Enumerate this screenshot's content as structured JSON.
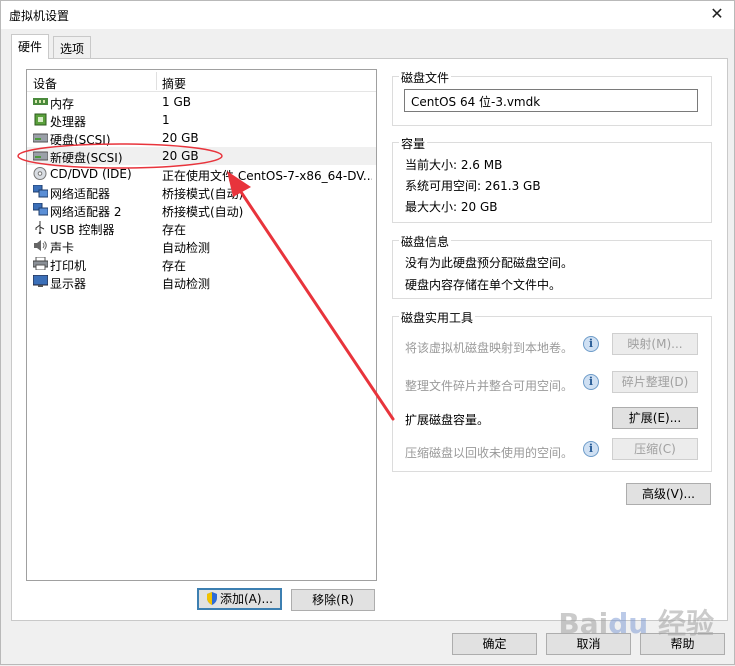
{
  "window": {
    "title": "虚拟机设置"
  },
  "tabs": [
    {
      "label": "硬件"
    },
    {
      "label": "选项"
    }
  ],
  "device_list": {
    "headers": {
      "device": "设备",
      "summary": "摘要"
    },
    "rows": [
      {
        "name": "内存",
        "summary": "1 GB",
        "icon": "memory-icon"
      },
      {
        "name": "处理器",
        "summary": "1",
        "icon": "processor-icon"
      },
      {
        "name": "硬盘(SCSI)",
        "summary": "20 GB",
        "icon": "hard-disk-icon"
      },
      {
        "name": "新硬盘(SCSI)",
        "summary": "20 GB",
        "icon": "hard-disk-icon"
      },
      {
        "name": "CD/DVD (IDE)",
        "summary": "正在使用文件 CentOS-7-x86_64-DV...",
        "icon": "cd-dvd-icon"
      },
      {
        "name": "网络适配器",
        "summary": "桥接模式(自动)",
        "icon": "network-adapter-icon"
      },
      {
        "name": "网络适配器 2",
        "summary": "桥接模式(自动)",
        "icon": "network-adapter-icon"
      },
      {
        "name": "USB 控制器",
        "summary": "存在",
        "icon": "usb-icon"
      },
      {
        "name": "声卡",
        "summary": "自动检测",
        "icon": "sound-card-icon"
      },
      {
        "name": "打印机",
        "summary": "存在",
        "icon": "printer-icon"
      },
      {
        "name": "显示器",
        "summary": "自动检测",
        "icon": "display-icon"
      }
    ],
    "selected_index": 3
  },
  "buttons": {
    "add": "添加(A)...",
    "remove": "移除(R)"
  },
  "disk_file": {
    "title": "磁盘文件",
    "value": "CentOS 64 位-3.vmdk"
  },
  "capacity": {
    "title": "容量",
    "current_size": "当前大小: 2.6 MB",
    "available": "系统可用空间: 261.3 GB",
    "max_size": "最大大小: 20 GB"
  },
  "disk_info": {
    "title": "磁盘信息",
    "line1": "没有为此硬盘预分配磁盘空间。",
    "line2": "硬盘内容存储在单个文件中。"
  },
  "utilities": {
    "title": "磁盘实用工具",
    "map_desc": "将该虚拟机磁盘映射到本地卷。",
    "map_btn": "映射(M)...",
    "defrag_desc": "整理文件碎片并整合可用空间。",
    "defrag_btn": "碎片整理(D)",
    "expand_desc": "扩展磁盘容量。",
    "expand_btn": "扩展(E)...",
    "compact_desc": "压缩磁盘以回收未使用的空间。",
    "compact_btn": "压缩(C)"
  },
  "advanced_btn": "高级(V)...",
  "footer": {
    "ok": "确定",
    "cancel": "取消",
    "help": "帮助"
  },
  "colors": {
    "annotation": "#e8343c",
    "selected_row": "#f0f0f0",
    "accent": "#3c7fb1"
  }
}
